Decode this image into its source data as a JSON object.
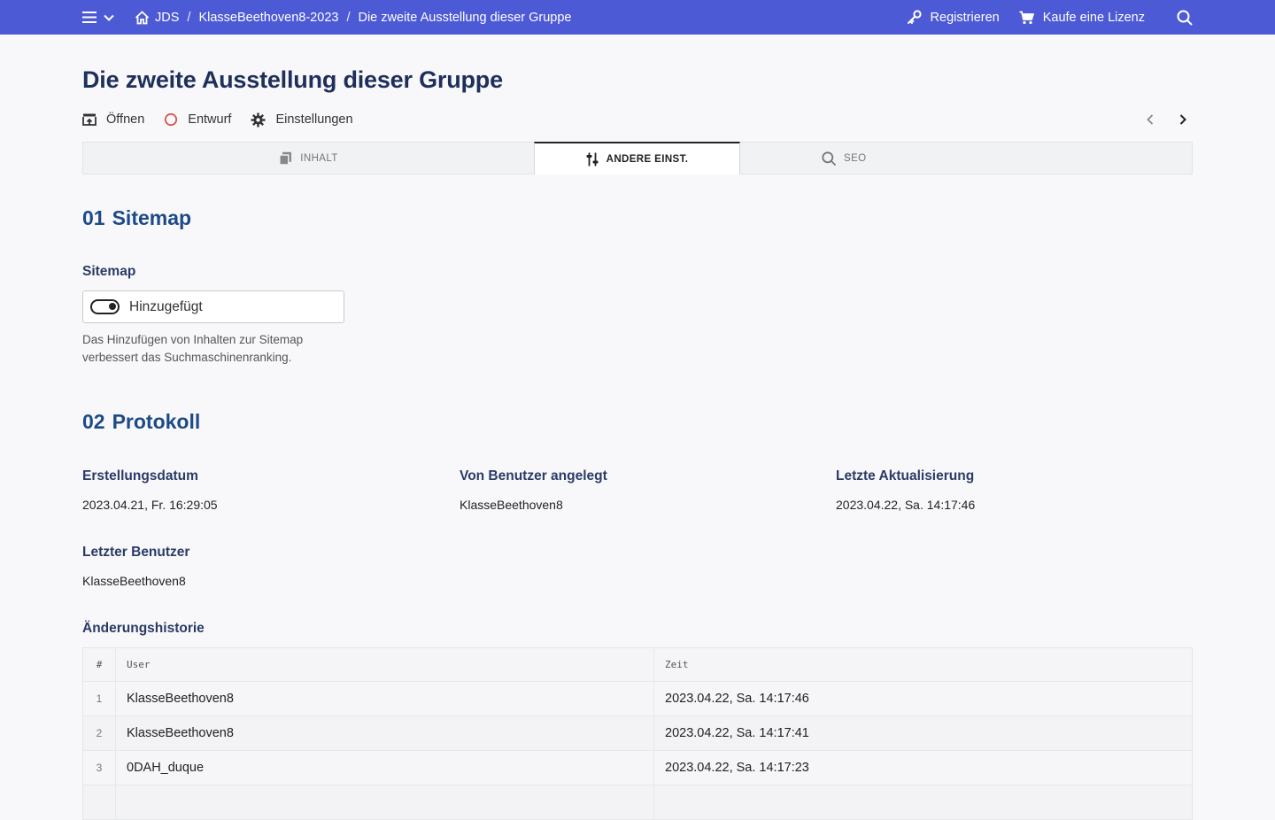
{
  "topbar": {
    "breadcrumb": [
      "JDS",
      "KlasseBeethoven8-2023",
      "Die zweite Ausstellung dieser Gruppe"
    ],
    "register_label": "Registrieren",
    "buy_label": "Kaufe eine Lizenz",
    "bg_color": "#4d5ad6"
  },
  "page": {
    "title": "Die zweite Ausstellung dieser Gruppe",
    "actions": {
      "open": "Öffnen",
      "draft": "Entwurf",
      "settings": "Einstellungen"
    }
  },
  "tabs": [
    {
      "label": "INHALT",
      "icon": "copy-icon"
    },
    {
      "label": "ANDERE EINST.",
      "icon": "sliders-icon",
      "active": true
    },
    {
      "label": "SEO",
      "icon": "search-icon"
    }
  ],
  "sections": {
    "sitemap": {
      "num": "01",
      "title": "Sitemap",
      "label": "Sitemap",
      "toggle_label": "Hinzugefügt",
      "toggle_on": true,
      "help": "Das Hinzufügen von Inhalten zur Sitemap verbessert das Suchmaschinenranking."
    },
    "protocol": {
      "num": "02",
      "title": "Protokoll",
      "created_label": "Erstellungsdatum",
      "created_value": "2023.04.21, Fr. 16:29:05",
      "creator_label": "Von Benutzer angelegt",
      "creator_value": "KlasseBeethoven8",
      "updated_label": "Letzte Aktualisierung",
      "updated_value": "2023.04.22, Sa. 14:17:46",
      "last_user_label": "Letzter Benutzer",
      "last_user_value": "KlasseBeethoven8",
      "history_label": "Änderungshistorie",
      "history_headers": [
        "#",
        "User",
        "Zeit"
      ],
      "history": [
        {
          "n": "1",
          "user": "KlasseBeethoven8",
          "time": "2023.04.22, Sa. 14:17:46"
        },
        {
          "n": "2",
          "user": "KlasseBeethoven8",
          "time": "2023.04.22, Sa. 14:17:41"
        },
        {
          "n": "3",
          "user": "0DAH_duque",
          "time": "2023.04.22, Sa. 14:17:23"
        }
      ]
    }
  }
}
